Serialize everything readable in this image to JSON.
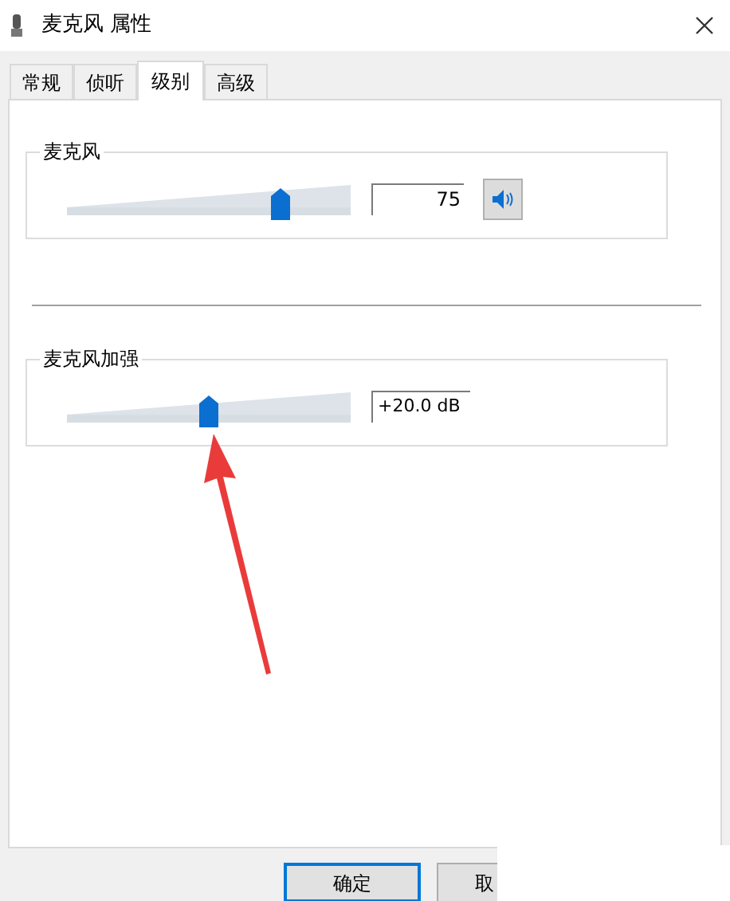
{
  "window": {
    "title": "麦克风 属性"
  },
  "tabs": [
    {
      "label": "常规",
      "selected": false
    },
    {
      "label": "侦听",
      "selected": false
    },
    {
      "label": "级别",
      "selected": true
    },
    {
      "label": "高级",
      "selected": false
    }
  ],
  "groups": [
    {
      "kind": "volume",
      "title": "麦克风",
      "level": 0.75,
      "value": "75"
    },
    {
      "kind": "boost",
      "title": "麦克风加强",
      "level": 0.5,
      "value": "+20.0 dB"
    }
  ],
  "buttons": [
    {
      "label": "确定",
      "selected": true
    },
    {
      "label": "取",
      "selected": false
    }
  ]
}
